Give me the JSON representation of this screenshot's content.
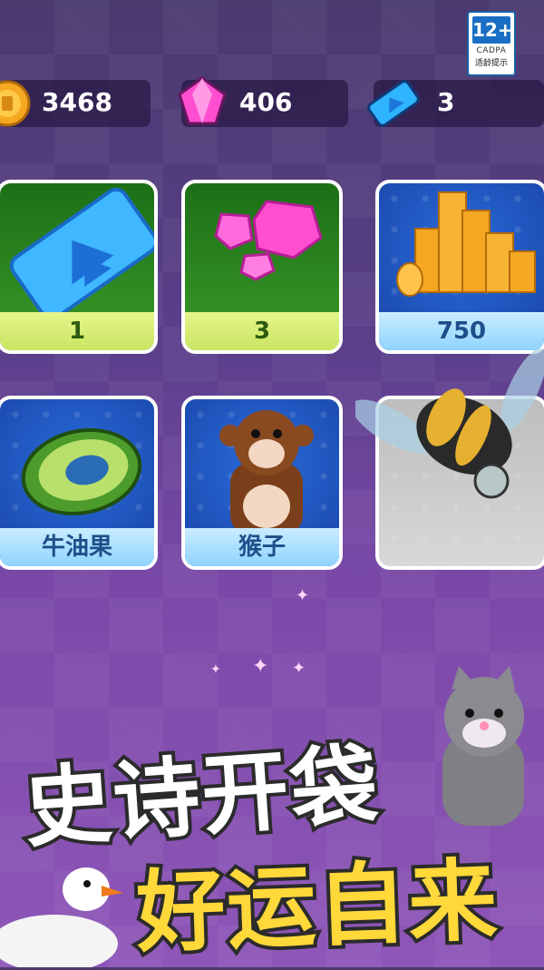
{
  "age_rating": {
    "number": "12+",
    "org": "CADPA",
    "tip": "适龄提示"
  },
  "currencies": [
    {
      "icon": "gold-coin-icon",
      "value": "3468"
    },
    {
      "icon": "pink-gem-icon",
      "value": "406"
    },
    {
      "icon": "blue-ticket-icon",
      "value": "3"
    }
  ],
  "rewards": [
    {
      "icon": "blue-ticket-icon",
      "label": "1",
      "style": "green"
    },
    {
      "icon": "pink-gems-icon",
      "label": "3",
      "style": "green"
    },
    {
      "icon": "gold-coins-stack-icon",
      "label": "750",
      "style": "blue"
    },
    {
      "icon": "avocado-float-icon",
      "label": "牛油果",
      "style": "blue"
    },
    {
      "icon": "monkey-icon",
      "label": "猴子",
      "style": "blue"
    },
    {
      "icon": "bee-icon",
      "label": "",
      "style": "gray"
    }
  ],
  "banner": {
    "line1": "史诗开袋",
    "line2": "好运自来"
  },
  "colors": {
    "green_label": "#c9e563",
    "blue_label": "#8fd3ff",
    "banner_white": "#ffffff",
    "banner_yellow": "#ffd83a"
  }
}
